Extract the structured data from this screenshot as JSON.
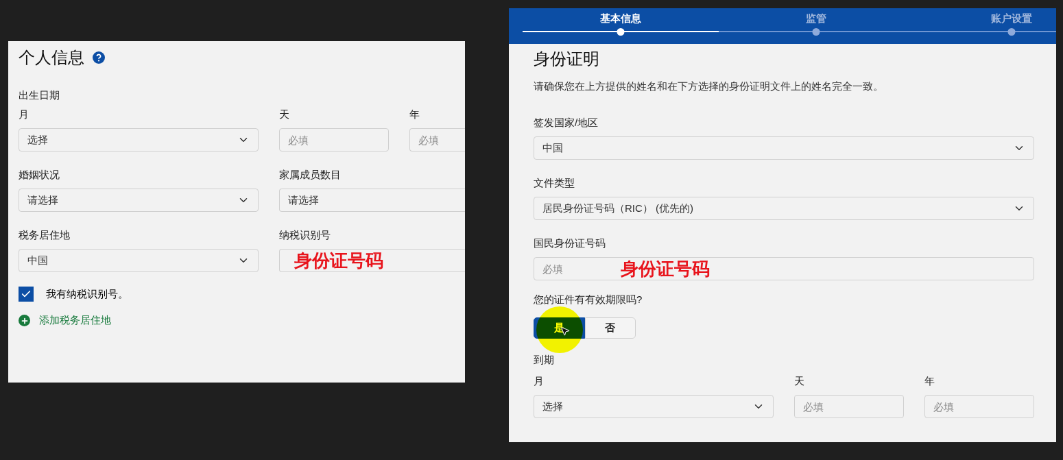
{
  "left_panel": {
    "title": "个人信息",
    "birth_date": {
      "label": "出生日期",
      "month": {
        "label": "月",
        "value": "选择"
      },
      "day": {
        "label": "天",
        "placeholder": "必填"
      },
      "year": {
        "label": "年",
        "placeholder": "必填"
      }
    },
    "marital_status": {
      "label": "婚姻状况",
      "value": "请选择"
    },
    "dependents": {
      "label": "家属成员数目",
      "value": "请选择"
    },
    "tax_residence": {
      "label": "税务居住地",
      "value": "中国"
    },
    "tax_id": {
      "label": "纳税识别号",
      "annotation": "身份证号码"
    },
    "has_tax_id": {
      "label": "我有纳税识别号。",
      "checked": true
    },
    "add_link": "添加税务居住地"
  },
  "right_panel": {
    "steps": [
      {
        "label": "基本信息",
        "selected": true
      },
      {
        "label": "监管",
        "selected": false
      },
      {
        "label": "账户设置",
        "selected": false
      }
    ],
    "title": "身份证明",
    "description": "请确保您在上方提供的姓名和在下方选择的身份证明文件上的姓名完全一致。",
    "issuing_country": {
      "label": "签发国家/地区",
      "value": "中国"
    },
    "document_type": {
      "label": "文件类型",
      "value": "居民身份证号码（RIC） (优先的)"
    },
    "id_number": {
      "label": "国民身份证号码",
      "placeholder": "必填",
      "annotation": "身份证号码"
    },
    "expiry_question": {
      "label": "您的证件有有效期限吗?",
      "options": [
        {
          "label": "是",
          "selected": true
        },
        {
          "label": "否",
          "selected": false
        }
      ]
    },
    "expiry": {
      "label": "到期",
      "month": {
        "label": "月",
        "value": "选择"
      },
      "day": {
        "label": "天",
        "placeholder": "必填"
      },
      "year": {
        "label": "年",
        "placeholder": "必填"
      }
    }
  }
}
